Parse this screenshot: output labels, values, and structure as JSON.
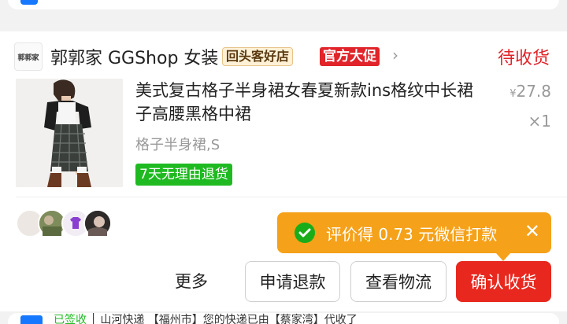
{
  "shop": {
    "logo_text": "郭郭家",
    "name": "郭郭家 GGShop 女装",
    "badge_return": "回头客好店",
    "badge_official": "官方大促",
    "chevron": "›",
    "status": "待收货"
  },
  "product": {
    "title": "美式复古格子半身裙女春夏新款ins格纹中长裙子高腰黑格中裙",
    "price_symbol": "¥",
    "price": "27.8",
    "quantity": "×1",
    "sku": "格子半身裙,S",
    "return_tag": "7天无理由退货"
  },
  "toast": {
    "text": "评价得 0.73 元微信打款",
    "close": "✕"
  },
  "actions": {
    "more": "更多",
    "refund": "申请退款",
    "logistics": "查看物流",
    "confirm": "确认收货"
  },
  "bottom_peek": {
    "prefix": "已签收",
    "text": "│ 山河快递 【福州市】您的快递已由【蔡家湾】代收了"
  },
  "colors": {
    "status_red": "#e0242a",
    "confirm_red": "#e8281f",
    "toast_orange": "#f5a11a",
    "return_green": "#1fba21"
  }
}
